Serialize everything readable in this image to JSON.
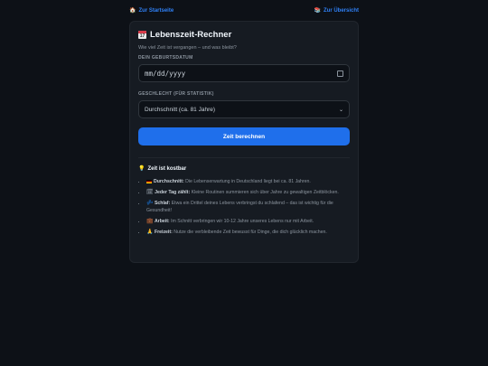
{
  "nav": {
    "home": {
      "icon": "🏠",
      "label": "Zur Startseite"
    },
    "overview": {
      "icon": "📚",
      "label": "Zur Übersicht"
    }
  },
  "card": {
    "title": "Lebenszeit-Rechner",
    "subtitle": "Wie viel Zeit ist vergangen – und was bleibt?",
    "birthdate_label": "Dein Geburtsdatum",
    "birthdate_placeholder": "mm/dd/yyyy",
    "gender_label": "Geschlecht (für Statistik)",
    "gender_selected": "Durchschnitt (ca. 81 Jahre)",
    "submit_label": "Zeit berechnen"
  },
  "info": {
    "icon": "💡",
    "title": "Zeit ist kostbar",
    "items": [
      {
        "icon": "de-flag-icon",
        "bold": "Durchschnitt:",
        "text": " Die Lebenserwartung in Deutschland liegt bei ca. 81 Jahren."
      },
      {
        "icon": "🗓",
        "bold": "Jeder Tag zählt:",
        "text": " Kleine Routinen summieren sich über Jahre zu gewaltigen Zeitblöcken."
      },
      {
        "icon": "💤",
        "bold": "Schlaf:",
        "text": " Etwa ein Drittel deines Lebens verbringst du schlafend – das ist wichtig für die Gesundheit!"
      },
      {
        "icon": "💼",
        "bold": "Arbeit:",
        "text": " Im Schnitt verbringen wir 10-12 Jahre unseres Lebens nur mit Arbeit."
      },
      {
        "icon": "🙏",
        "bold": "Freizeit:",
        "text": " Nutze die verbleibende Zeit bewusst für Dinge, die dich glücklich machen."
      }
    ]
  },
  "colors": {
    "background": "#0d1117",
    "card": "#161b22",
    "accent": "#1f6feb",
    "link": "#2f81f7"
  }
}
